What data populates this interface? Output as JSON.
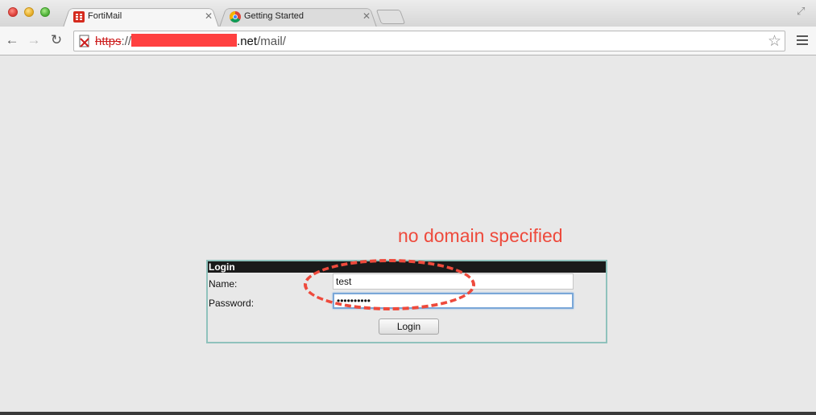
{
  "browser": {
    "tabs": [
      {
        "title": "FortiMail",
        "active": true,
        "icon": "fortinet-icon"
      },
      {
        "title": "Getting Started",
        "active": false,
        "icon": "chrome-icon"
      }
    ],
    "url": {
      "scheme": "https",
      "separator": "://",
      "host_suffix": ".net",
      "path": "/mail/"
    }
  },
  "annotation": {
    "text": "no domain specified",
    "color": "#ee4a3c"
  },
  "login": {
    "header": "Login",
    "name_label": "Name:",
    "name_value": "test",
    "password_label": "Password:",
    "password_value": "••••••••••",
    "button_label": "Login"
  }
}
